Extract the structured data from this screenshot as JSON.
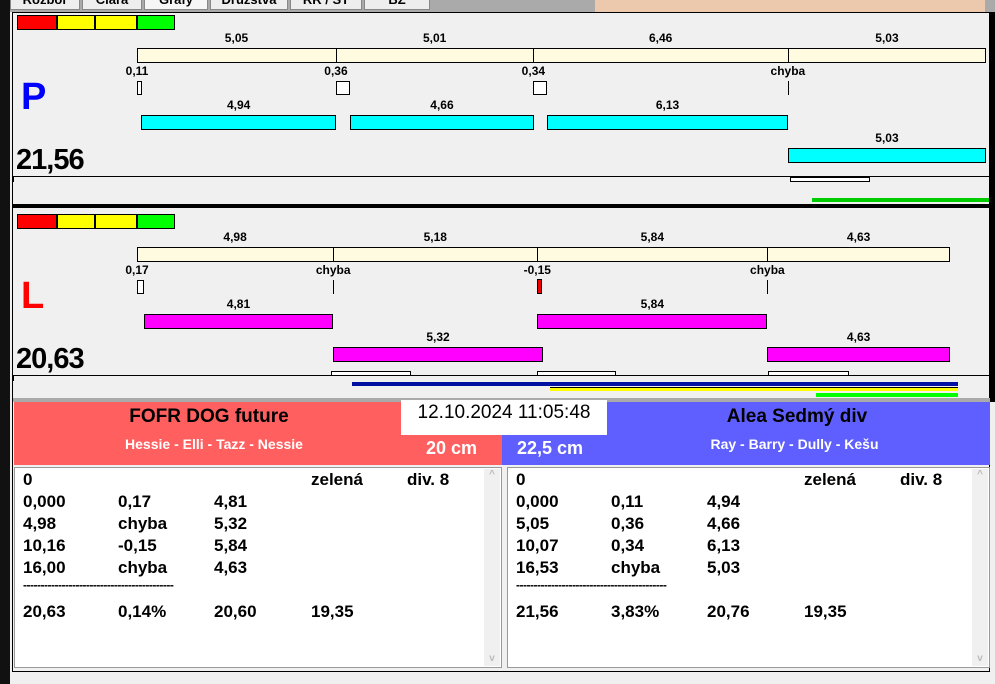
{
  "tabs": [
    "Rozbor",
    "Čiara",
    "Grafy",
    "Družstva",
    "RR / ST",
    "BZ"
  ],
  "colors": {
    "red": "#ff0000",
    "yellow": "#ffff00",
    "green": "#00ff00",
    "track": "#fffbe0",
    "P_bar": "#00ffff",
    "L_bar": "#ff00ff",
    "left_header": "#ff5f5f",
    "right_header": "#5f5fff"
  },
  "panels": [
    {
      "letter": "P",
      "letter_color": "#0000ff",
      "total": "21,56",
      "bar_color": "#00ffff",
      "splits": [
        "5,05",
        "5,01",
        "6,46",
        "5,03"
      ],
      "reactions": [
        "0,11",
        "0,36",
        "0,34",
        "chyba"
      ],
      "runs": [
        "4,94",
        "4,66",
        "6,13",
        "5,03"
      ]
    },
    {
      "letter": "L",
      "letter_color": "#ff0000",
      "total": "20,63",
      "bar_color": "#ff00ff",
      "splits": [
        "4,98",
        "5,18",
        "5,84",
        "4,63"
      ],
      "reactions": [
        "0,17",
        "chyba",
        "-0,15",
        "chyba"
      ],
      "runs": [
        "4,81",
        "5,32",
        "5,84",
        "4,63"
      ]
    }
  ],
  "timestamp": "12.10.2024 11:05:48",
  "left": {
    "team": "FOFR DOG future",
    "dogs": "Hessie - Elli - Tazz - Nessie",
    "height": "20 cm",
    "table": {
      "header": [
        "0",
        "",
        "",
        "zelená",
        "div. 8"
      ],
      "rows": [
        [
          "0,000",
          "0,17",
          "4,81"
        ],
        [
          "4,98",
          "chyba",
          "5,32"
        ],
        [
          "10,16",
          "-0,15",
          "5,84"
        ],
        [
          "16,00",
          "chyba",
          "4,63"
        ]
      ],
      "separator": "-------------------------------------------",
      "summary": [
        "20,63",
        "0,14%",
        "20,60",
        "19,35"
      ]
    }
  },
  "right": {
    "team": "Alea Sedmý div",
    "dogs": "Ray - Barry - Dully - Kešu",
    "height": "22,5 cm",
    "table": {
      "header": [
        "0",
        "",
        "",
        "zelená",
        "div. 8"
      ],
      "rows": [
        [
          "0,000",
          "0,11",
          "4,94"
        ],
        [
          "5,05",
          "0,36",
          "4,66"
        ],
        [
          "10,07",
          "0,34",
          "6,13"
        ],
        [
          "16,53",
          "chyba",
          "5,03"
        ]
      ],
      "separator": "-------------------------------------------",
      "summary": [
        "21,56",
        "3,83%",
        "20,76",
        "19,35"
      ]
    }
  }
}
